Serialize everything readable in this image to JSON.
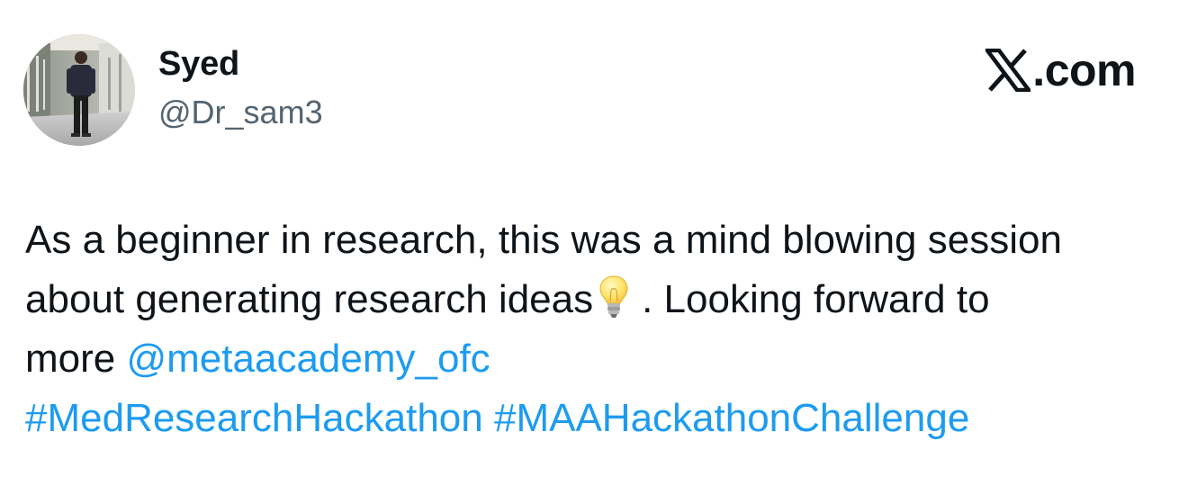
{
  "author": {
    "name": "Syed",
    "handle": "@Dr_sam3"
  },
  "brand": {
    "label": ".com",
    "logo_icon": "x-logo-icon"
  },
  "tweet": {
    "line1": "As a beginner in research, this was a mind blowing session",
    "line2_before": "about generating research ideas",
    "line2_emoji": "light-bulb-icon",
    "line2_after": ". Looking forward to",
    "line3_before": "more ",
    "mention": "@metaacademy_ofc",
    "hashtag1": "#MedResearchHackathon",
    "hashtag2": "#MAAHackathonChallenge"
  },
  "colors": {
    "text": "#0f1419",
    "secondary": "#536471",
    "link": "#1d9bf0"
  }
}
